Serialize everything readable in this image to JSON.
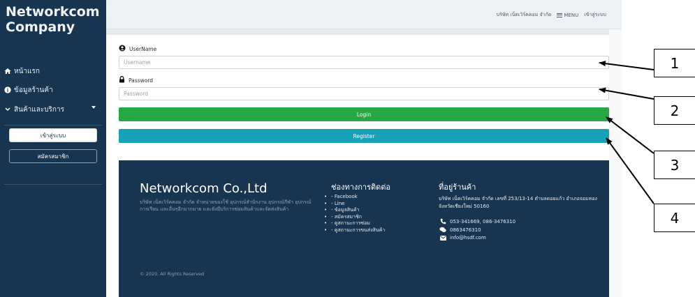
{
  "sidebar": {
    "brand": "Networkcom Company",
    "items": [
      {
        "label": "หน้าแรก",
        "icon": "home-icon"
      },
      {
        "label": "ข้อมูลร้านค้า",
        "icon": "info-icon"
      },
      {
        "label": "สินค้าและบริการ",
        "icon": "chevron-down-icon"
      }
    ],
    "login_label": "เข้าสู่ระบบ",
    "register_label": "สมัครสมาชิก"
  },
  "topbar": {
    "company": "บริษัท เน็ตเวิร์คคอม จำกัด",
    "menu_label": "MENU",
    "login_link": "เข้าสู่ระบบ"
  },
  "form": {
    "username_label": "UserName",
    "username_placeholder": "Username",
    "password_label": "Password",
    "password_placeholder": "Password",
    "login_button": "Login",
    "register_button": "Register"
  },
  "footer": {
    "title": "Networkcom Co.,Ltd",
    "description": "บริษัท เน็ตเวิร์คคอม จำกัด จำหน่ายของใช้ อุปกรณ์สำนักงาน อุปกรณ์กีฬา อุปกรณ์การเรียน และอื่นๆอีกมากมาย และยังมีบริการซ่อมสินค้าและจัดส่งสินค้า",
    "channels_title": "ช่องทางการติดต่อ",
    "channels": [
      "- Facebook",
      "- Line",
      "- ข้อมูลสินค้า",
      "- สมัครสมาชิก",
      "- ดูสถานะการซ่อม",
      "- ดูสถานะการขนส่งสินค้า"
    ],
    "address_title": "ที่อยู่ร้านค้า",
    "address": "บริษัท เน็ตเวิร์คคอม จำกัด เลขที่ 253/13-14 ตำบลดอยแก้ว อำเภอจอมทอง จังหวัดเชียงใหม่ 50160",
    "phone": "053-341669, 086-3476310",
    "line_id": "0863476310",
    "email": "info@hsdf.com",
    "copyright": "© 2020. All Rights Reserved"
  },
  "callouts": [
    "1",
    "2",
    "3",
    "4"
  ]
}
